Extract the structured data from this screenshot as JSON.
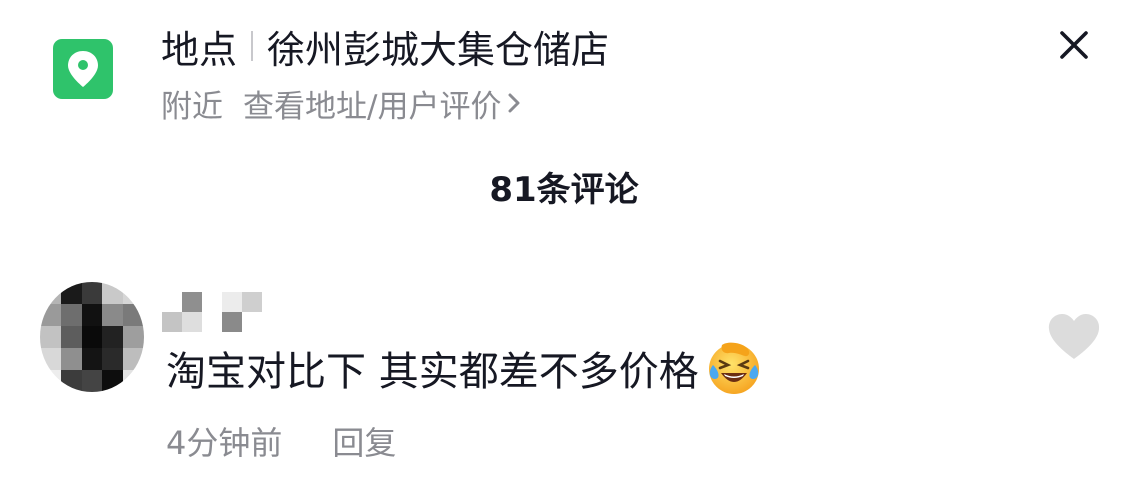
{
  "header": {
    "location_label": "地点",
    "store_name": "徐州彭城大集仓储店",
    "nearby": "附近",
    "view_link": "查看地址/用户评价"
  },
  "comments_title": "81条评论",
  "comment": {
    "text": "淘宝对比下 其实都差不多价格",
    "time": "4分钟前",
    "reply_label": "回复"
  },
  "icons": {
    "location": "location-pin-icon",
    "close": "close-icon",
    "chevron": "chevron-right-icon",
    "like": "heart-icon",
    "emoji": "laughing-crying-emoji"
  },
  "colors": {
    "accent_green": "#2fc36b",
    "text_primary": "#161823",
    "text_secondary": "#8a8b91",
    "heart": "#dcdcdc"
  }
}
